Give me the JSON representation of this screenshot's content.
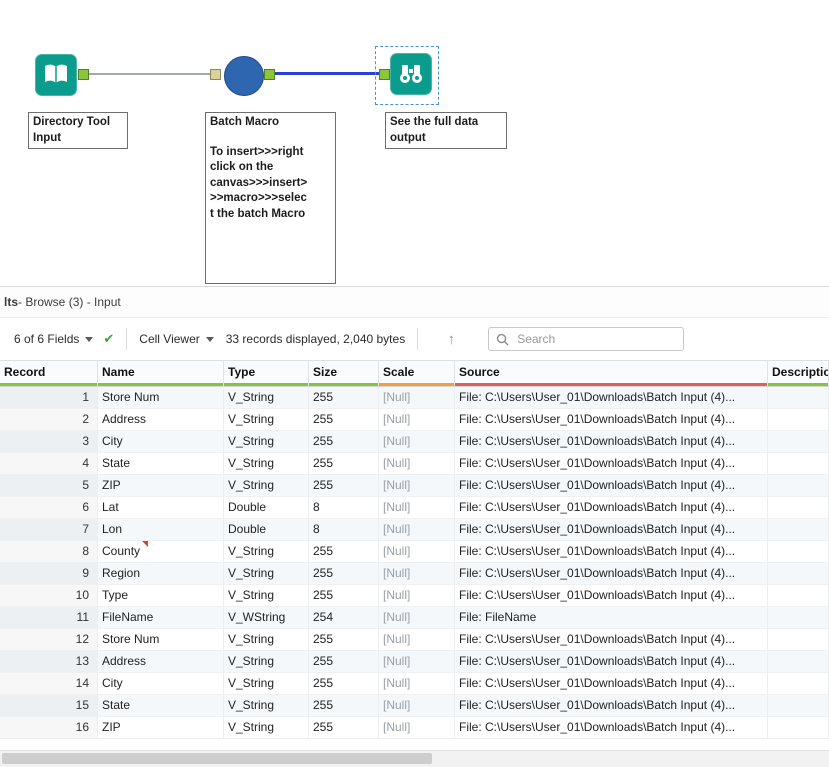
{
  "canvas": {
    "directory_tool": {
      "label_line1": "Directory Tool",
      "label_line2": "Input"
    },
    "batch_macro": {
      "title": "Batch Macro",
      "annotation": [
        "To insert>>>right",
        "click on the",
        "canvas>>>insert>",
        ">>macro>>>selec",
        "t the batch Macro"
      ]
    },
    "browse_tool": {
      "label_line1": "See the full data",
      "label_line2": "output"
    },
    "colors": {
      "tool_teal": "#0b9c8e",
      "macro_blue": "#2e66b0",
      "anchor_green": "#8cc63f",
      "selected_connection_blue": "#2b3fd4"
    }
  },
  "results": {
    "title_bold": "lts",
    "title_rest": " - Browse (3) - Input",
    "toolbar": {
      "fields_label": "6 of 6 Fields",
      "cell_viewer_label": "Cell Viewer",
      "records_info": "33 records displayed, 2,040 bytes",
      "search_placeholder": "Search"
    },
    "table": {
      "columns": [
        {
          "label": "Record",
          "quality": "#84c441"
        },
        {
          "label": "Name",
          "quality": "#84c441"
        },
        {
          "label": "Type",
          "quality": "#84c441"
        },
        {
          "label": "Size",
          "quality": "#84c441"
        },
        {
          "label": "Scale",
          "quality": "#f2a03d"
        },
        {
          "label": "Source",
          "quality": "#e25d5d"
        },
        {
          "label": "Description",
          "quality": "#84c441"
        }
      ],
      "rows": [
        {
          "record": "1",
          "name": "Store Num",
          "type": "V_String",
          "size": "255",
          "scale": "[Null]",
          "source": "File: C:\\Users\\User_01\\Downloads\\Batch Input (4)...",
          "description": ""
        },
        {
          "record": "2",
          "name": "Address",
          "type": "V_String",
          "size": "255",
          "scale": "[Null]",
          "source": "File: C:\\Users\\User_01\\Downloads\\Batch Input (4)...",
          "description": ""
        },
        {
          "record": "3",
          "name": "City",
          "type": "V_String",
          "size": "255",
          "scale": "[Null]",
          "source": "File: C:\\Users\\User_01\\Downloads\\Batch Input (4)...",
          "description": ""
        },
        {
          "record": "4",
          "name": "State",
          "type": "V_String",
          "size": "255",
          "scale": "[Null]",
          "source": "File: C:\\Users\\User_01\\Downloads\\Batch Input (4)...",
          "description": ""
        },
        {
          "record": "5",
          "name": "ZIP",
          "type": "V_String",
          "size": "255",
          "scale": "[Null]",
          "source": "File: C:\\Users\\User_01\\Downloads\\Batch Input (4)...",
          "description": ""
        },
        {
          "record": "6",
          "name": "Lat",
          "type": "Double",
          "size": "8",
          "scale": "[Null]",
          "source": "File: C:\\Users\\User_01\\Downloads\\Batch Input (4)...",
          "description": ""
        },
        {
          "record": "7",
          "name": "Lon",
          "type": "Double",
          "size": "8",
          "scale": "[Null]",
          "source": "File: C:\\Users\\User_01\\Downloads\\Batch Input (4)...",
          "description": ""
        },
        {
          "record": "8",
          "name": "County",
          "type": "V_String",
          "size": "255",
          "scale": "[Null]",
          "source": "File: C:\\Users\\User_01\\Downloads\\Batch Input (4)...",
          "description": "",
          "flag": true
        },
        {
          "record": "9",
          "name": "Region",
          "type": "V_String",
          "size": "255",
          "scale": "[Null]",
          "source": "File: C:\\Users\\User_01\\Downloads\\Batch Input (4)...",
          "description": ""
        },
        {
          "record": "10",
          "name": "Type",
          "type": "V_String",
          "size": "255",
          "scale": "[Null]",
          "source": "File: C:\\Users\\User_01\\Downloads\\Batch Input (4)...",
          "description": ""
        },
        {
          "record": "11",
          "name": "FileName",
          "type": "V_WString",
          "size": "254",
          "scale": "[Null]",
          "source": "File: FileName",
          "description": ""
        },
        {
          "record": "12",
          "name": "Store Num",
          "type": "V_String",
          "size": "255",
          "scale": "[Null]",
          "source": "File: C:\\Users\\User_01\\Downloads\\Batch Input (4)...",
          "description": ""
        },
        {
          "record": "13",
          "name": "Address",
          "type": "V_String",
          "size": "255",
          "scale": "[Null]",
          "source": "File: C:\\Users\\User_01\\Downloads\\Batch Input (4)...",
          "description": ""
        },
        {
          "record": "14",
          "name": "City",
          "type": "V_String",
          "size": "255",
          "scale": "[Null]",
          "source": "File: C:\\Users\\User_01\\Downloads\\Batch Input (4)...",
          "description": ""
        },
        {
          "record": "15",
          "name": "State",
          "type": "V_String",
          "size": "255",
          "scale": "[Null]",
          "source": "File: C:\\Users\\User_01\\Downloads\\Batch Input (4)...",
          "description": ""
        },
        {
          "record": "16",
          "name": "ZIP",
          "type": "V_String",
          "size": "255",
          "scale": "[Null]",
          "source": "File: C:\\Users\\User_01\\Downloads\\Batch Input (4)...",
          "description": ""
        }
      ]
    }
  }
}
